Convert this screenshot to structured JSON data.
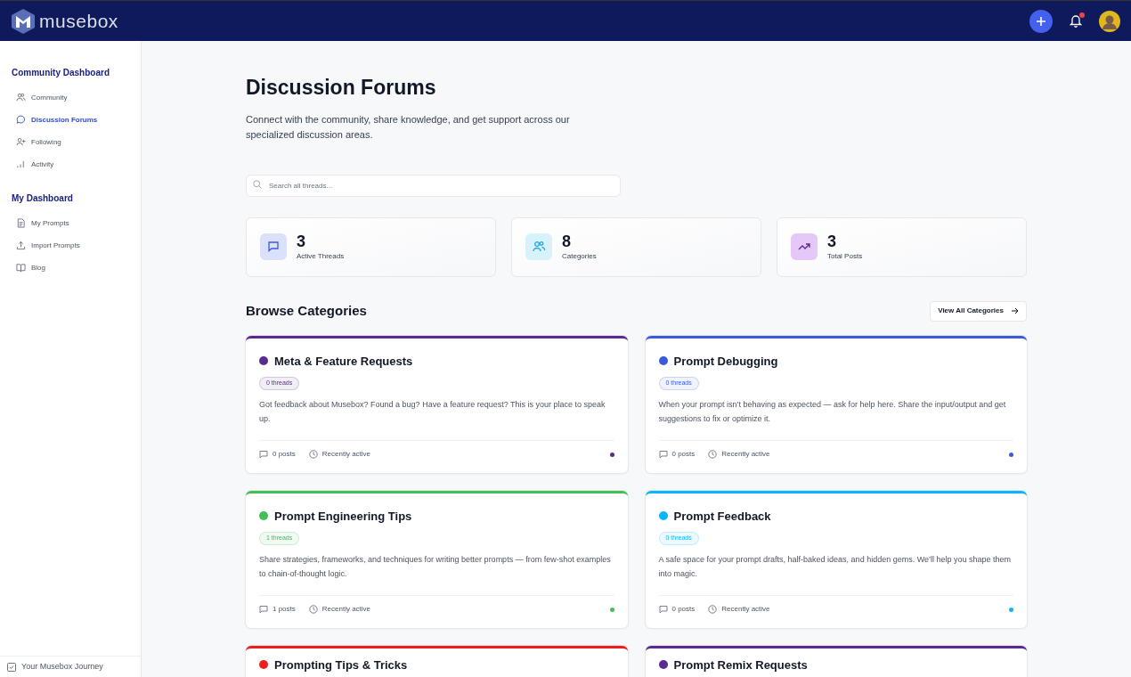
{
  "header": {
    "brand": "musebox",
    "notifications_unread": true
  },
  "sidebar": {
    "sections": [
      {
        "title": "Community Dashboard",
        "items": [
          {
            "label": "Community",
            "selected": false
          },
          {
            "label": "Discussion Forums",
            "selected": true
          },
          {
            "label": "Following",
            "selected": false
          },
          {
            "label": "Activity",
            "selected": false
          }
        ]
      },
      {
        "title": "My Dashboard",
        "items": [
          {
            "label": "My Prompts",
            "selected": false
          },
          {
            "label": "Import Prompts",
            "selected": false
          },
          {
            "label": "Blog",
            "selected": false
          }
        ]
      }
    ],
    "footer": "Your Musebox Journey"
  },
  "page": {
    "title": "Discussion Forums",
    "subtitle": "Connect with the community, share knowledge, and get support across our specialized discussion areas."
  },
  "search": {
    "placeholder": "Search all threads..."
  },
  "stats": [
    {
      "value": "3",
      "label": "Active Threads"
    },
    {
      "value": "8",
      "label": "Categories"
    },
    {
      "value": "3",
      "label": "Total Posts"
    }
  ],
  "browse": {
    "title": "Browse Categories",
    "button": "View All Categories"
  },
  "categories": [
    {
      "name": "Meta & Feature Requests",
      "color": "#5b2a91",
      "threads": "0 threads",
      "description": "Got feedback about Musebox? Found a bug? Have a feature request? This is your place to speak up.",
      "posts": "0 posts",
      "activity": "Recently active"
    },
    {
      "name": "Prompt Debugging",
      "color": "#3b5bdb",
      "threads": "0 threads",
      "description": "When your prompt isn’t behaving as expected — ask for help here. Share the input/output and get suggestions to fix or optimize it.",
      "posts": "0 posts",
      "activity": "Recently active"
    },
    {
      "name": "Prompt Engineering Tips",
      "color": "#40c057",
      "threads": "1 threads",
      "description": "Share strategies, frameworks, and techniques for writing better prompts — from few-shot examples to chain-of-thought logic.",
      "posts": "1 posts",
      "activity": "Recently active"
    },
    {
      "name": "Prompt Feedback",
      "color": "#0bb4ff",
      "threads": "0 threads",
      "description": "A safe space for your prompt drafts, half-baked ideas, and hidden gems. We’ll help you shape them into magic.",
      "posts": "0 posts",
      "activity": "Recently active"
    },
    {
      "name": "Prompting Tips & Tricks",
      "color": "#f01d1d"
    },
    {
      "name": "Prompt Remix Requests",
      "color": "#5b2a91"
    }
  ]
}
